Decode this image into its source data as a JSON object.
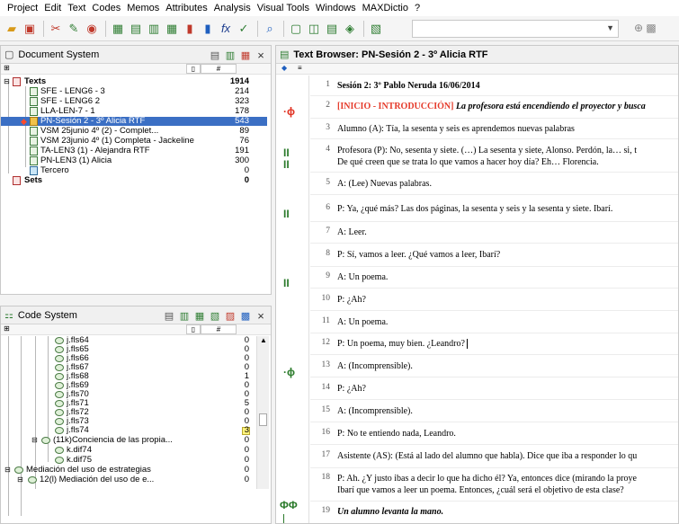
{
  "menu": [
    "Project",
    "Edit",
    "Text",
    "Codes",
    "Memos",
    "Attributes",
    "Analysis",
    "Visual Tools",
    "Windows",
    "MAXDictio",
    "?"
  ],
  "toolbar_icons": [
    "open-folder-icon",
    "save-icon",
    "cut-icon",
    "color-icon",
    "graph-icon",
    "variable-icon",
    "import-icon",
    "table-icon",
    "chart-icon",
    "bar-icon",
    "formula-icon",
    "edit-icon",
    "find-icon",
    "window-icon",
    "split-icon",
    "doc-icon",
    "code-icon",
    "dictio-icon"
  ],
  "doc_system": {
    "title": "Document System",
    "root": {
      "label": "Texts",
      "count": "1914"
    },
    "items": [
      {
        "label": "SFE - LENG6 - 3",
        "count": "214"
      },
      {
        "label": "SFE - LENG6 2",
        "count": "323"
      },
      {
        "label": "LLA-LEN-7 - 1",
        "count": "178"
      },
      {
        "label": "PN-Sesión 2 - 3º Alicia RTF",
        "count": "543"
      },
      {
        "label": "VSM 25junio 4º (2) - Complet...",
        "count": "89"
      },
      {
        "label": "VSM 23junio 4º (1) Completa - Jackeline",
        "count": "76"
      },
      {
        "label": "TA-LEN3 (1) - Alejandra RTF",
        "count": "191"
      },
      {
        "label": "PN-LEN3 (1) Alicia",
        "count": "300"
      },
      {
        "label": "Tercero",
        "count": "0"
      }
    ],
    "sets": {
      "label": "Sets",
      "count": "0"
    }
  },
  "code_system": {
    "title": "Code System",
    "items": [
      {
        "label": "j.fls64",
        "count": "0"
      },
      {
        "label": "j.fls65",
        "count": "0"
      },
      {
        "label": "j.fls66",
        "count": "0"
      },
      {
        "label": "j.fls67",
        "count": "0"
      },
      {
        "label": "j.fls68",
        "count": "1"
      },
      {
        "label": "j.fls69",
        "count": "0"
      },
      {
        "label": "j.fls70",
        "count": "0"
      },
      {
        "label": "j.fls71",
        "count": "5"
      },
      {
        "label": "j.fls72",
        "count": "0"
      },
      {
        "label": "j.fls73",
        "count": "0"
      },
      {
        "label": "j.fls74",
        "count": "3"
      },
      {
        "label": "(11k)Conciencia de las propia...",
        "count": "0"
      },
      {
        "label": "k.dif74",
        "count": "0"
      },
      {
        "label": "k.dif75",
        "count": "0"
      },
      {
        "label": "Mediación del uso de estrategias",
        "count": "0"
      },
      {
        "label": "12(l) Mediación del uso de e...",
        "count": "0"
      }
    ]
  },
  "text_browser": {
    "title": "Text Browser: PN-Sesión 2 - 3º Alicia RTF",
    "lines": [
      {
        "n": "1",
        "t": "Sesión 2: 3º Pablo Neruda 16/06/2014"
      },
      {
        "n": "2",
        "t1": "[INICIO - INTRODUCCIÓN]",
        "t2": " La profesora está encendiendo el proyector y busca"
      },
      {
        "n": "3",
        "t": "Alumno (A): Tía, la sesenta y seis es aprendemos nuevas palabras"
      },
      {
        "n": "4",
        "t": "Profesora (P): No, sesenta y siete. (…) La sesenta y siete, Alonso. Perdón, la… si, t",
        "t_b": "De qué creen que se trata lo que vamos a hacer hoy día? Eh… Florencia."
      },
      {
        "n": "5",
        "t": "A: (Lee) Nuevas palabras."
      },
      {
        "n": "6",
        "t": "P: Ya, ¿qué más? Las dos páginas, la sesenta y seis y la sesenta y siete. Ibarí."
      },
      {
        "n": "7",
        "t": "A: Leer."
      },
      {
        "n": "8",
        "t": "P: Sí, vamos a leer. ¿Qué vamos a leer, Ibarí?"
      },
      {
        "n": "9",
        "t": "A: Un poema."
      },
      {
        "n": "10",
        "t": "P: ¿Ah?"
      },
      {
        "n": "11",
        "t": "A: Un poema."
      },
      {
        "n": "12",
        "t": "P: Un poema, muy bien. ¿Leandro?"
      },
      {
        "n": "13",
        "t": "A: (Incomprensible)."
      },
      {
        "n": "14",
        "t": "P: ¿Ah?"
      },
      {
        "n": "15",
        "t": "A: (Incomprensible)."
      },
      {
        "n": "16",
        "t": "P: No te entiendo nada, Leandro."
      },
      {
        "n": "17",
        "t": "Asistente (AS): (Está al lado del alumno que habla). Dice que iba a responder lo qu"
      },
      {
        "n": "18",
        "t": "P: Ah. ¿Y justo ibas a decir lo que ha dicho él? Ya, entonces dice (mirando la proye",
        "t_b": "Ibarí que vamos a leer un poema. Entonces, ¿cuál será el objetivo de esta clase?"
      },
      {
        "n": "19",
        "t": "Un alumno levanta la mano."
      }
    ]
  },
  "colors": {
    "selection": "#3b6fc4",
    "code_red": "#e03020",
    "code_green": "#2a7a2a",
    "intro_red": "#e53a2a"
  }
}
